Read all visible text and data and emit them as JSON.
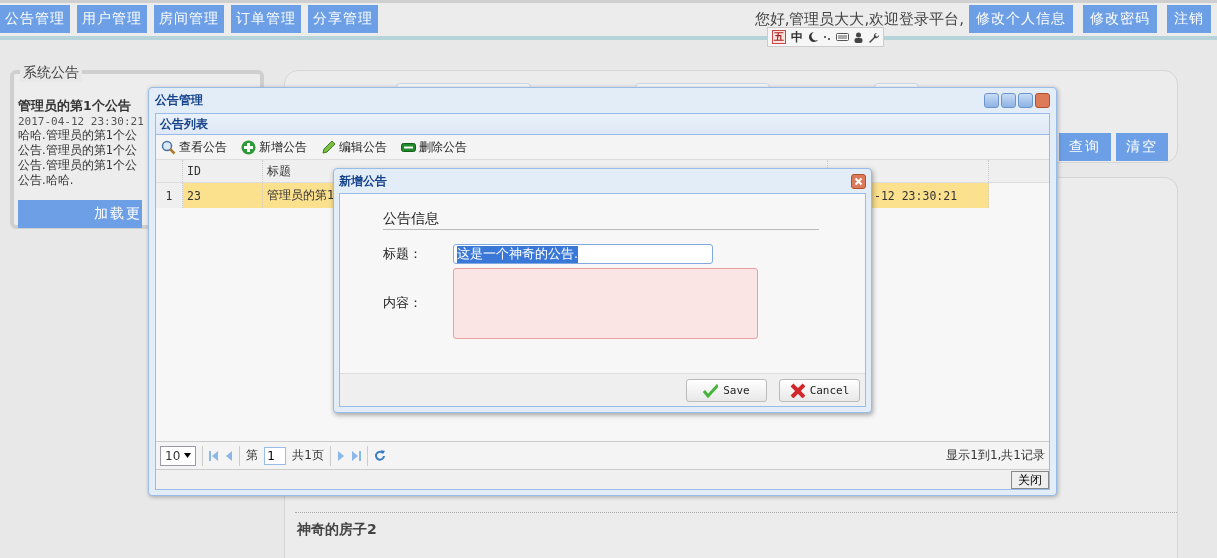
{
  "nav": {
    "tabs": [
      {
        "label": "公告管理"
      },
      {
        "label": "用户管理"
      },
      {
        "label": "房间管理"
      },
      {
        "label": "订单管理"
      },
      {
        "label": "分享管理"
      }
    ],
    "greeting": "您好,管理员大大,欢迎登录平台,",
    "actions": [
      "修改个人信息",
      "修改密码",
      "注销"
    ]
  },
  "ime_bar": {
    "labels": [
      "五",
      "中"
    ]
  },
  "notice_card": {
    "legend": "系统公告",
    "title": "管理员的第1个公告",
    "date": "2017-04-12 23:30:21",
    "lines": [
      "哈哈.管理员的第1个公",
      "公告.管理员的第1个公",
      "公告.管理员的第1个公",
      "公告.哈哈."
    ],
    "load_more": "加载更"
  },
  "search_panel": {
    "buttons": [
      "查询",
      "清空"
    ]
  },
  "content_panel": {
    "items": [
      {
        "title": "神奇的房子2"
      }
    ]
  },
  "window": {
    "title": "公告管理",
    "panel_title": "公告列表",
    "toolbar": [
      {
        "kind": "view",
        "label": "查看公告"
      },
      {
        "kind": "add",
        "label": "新增公告"
      },
      {
        "kind": "edit",
        "label": "编辑公告"
      },
      {
        "kind": "delete",
        "label": "删除公告"
      }
    ],
    "table": {
      "columns": [
        "ID",
        "标题"
      ],
      "rows": [
        {
          "row_number": "1",
          "id": "23",
          "title": "管理员的第1",
          "time": "-12 23:30:21",
          "selected": true
        }
      ]
    },
    "pager": {
      "page_size": "10",
      "page_label": "第",
      "page": "1",
      "page_total": "共1页",
      "summary": "显示1到1,共1记录"
    },
    "close_button": "关闭"
  },
  "dialog": {
    "title": "新增公告",
    "legend": "公告信息",
    "fields": [
      {
        "kind": "text",
        "label": "标题：",
        "value": "这是一个神奇的公告.",
        "text_selected": true,
        "invalid": false
      },
      {
        "kind": "textarea",
        "label": "内容：",
        "invalid": true
      }
    ],
    "buttons": [
      {
        "kind": "save",
        "label": "Save"
      },
      {
        "kind": "cancel",
        "label": "Cancel"
      }
    ]
  }
}
